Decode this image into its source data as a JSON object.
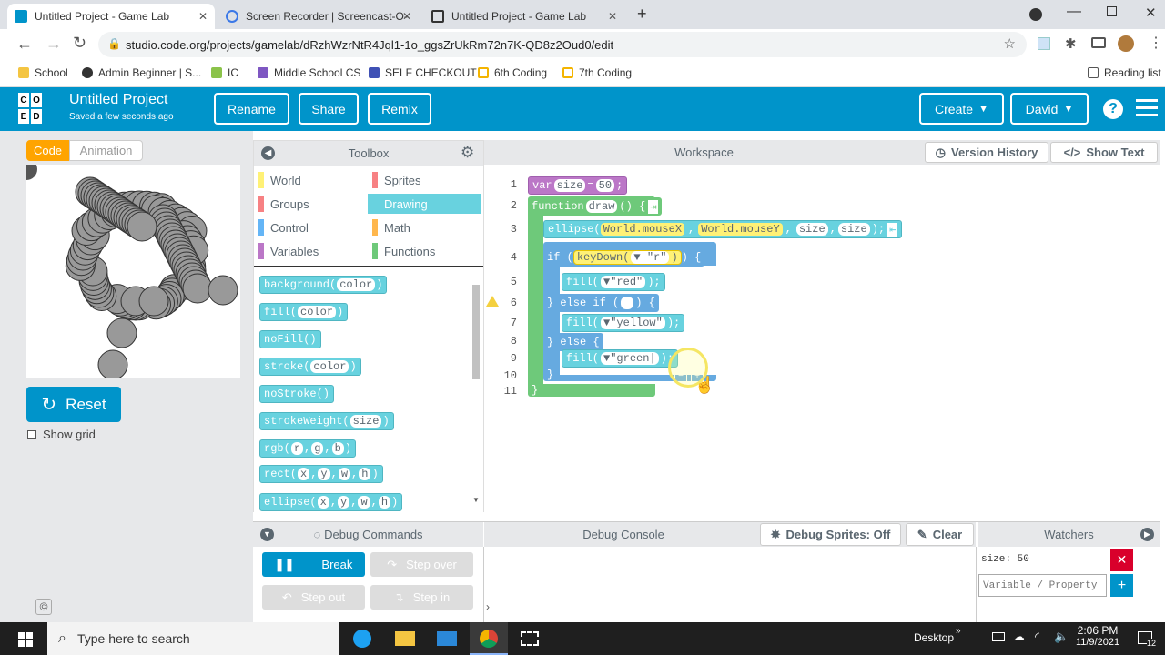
{
  "browser": {
    "tabs": [
      {
        "title": "Untitled Project - Game Lab",
        "active": true
      },
      {
        "title": "Screen Recorder | Screencast-O-",
        "active": false
      },
      {
        "title": "Untitled Project - Game Lab",
        "active": false
      }
    ],
    "url": "studio.code.org/projects/gamelab/dRzhWzrNtR4Jql1-1o_ggsZrUkRm72n7K-QD8z2Oud0/edit",
    "bookmarks": [
      "School",
      "Admin Beginner | S...",
      "IC",
      "Middle School CS",
      "SELF CHECKOUT",
      "6th Coding",
      "7th Coding"
    ],
    "reading_list": "Reading list"
  },
  "header": {
    "logo_letters": [
      "C",
      "O",
      "D",
      "E"
    ],
    "project_title": "Untitled Project",
    "saved_status": "Saved a few seconds ago",
    "rename": "Rename",
    "share": "Share",
    "remix": "Remix",
    "create": "Create",
    "user": "David",
    "help": "?"
  },
  "left": {
    "tab_code": "Code",
    "tab_animation": "Animation",
    "reset": "Reset",
    "show_grid": "Show grid",
    "copyright": "©"
  },
  "toolbox": {
    "title": "Toolbox",
    "categories": [
      {
        "label": "World",
        "color": "#fff176"
      },
      {
        "label": "Sprites",
        "color": "#f78183"
      },
      {
        "label": "Groups",
        "color": "#f78183"
      },
      {
        "label": "Drawing",
        "color": "#68d2df"
      },
      {
        "label": "Control",
        "color": "#64b5f6"
      },
      {
        "label": "Math",
        "color": "#ffb74d"
      },
      {
        "label": "Variables",
        "color": "#bb77c7"
      },
      {
        "label": "Functions",
        "color": "#6ec97a"
      }
    ],
    "selected": "Drawing",
    "blocks": [
      {
        "name": "background",
        "args": [
          "color"
        ]
      },
      {
        "name": "fill",
        "args": [
          "color"
        ]
      },
      {
        "name": "noFill",
        "args": []
      },
      {
        "name": "stroke",
        "args": [
          "color"
        ]
      },
      {
        "name": "noStroke",
        "args": []
      },
      {
        "name": "strokeWeight",
        "args": [
          "size"
        ]
      },
      {
        "name": "rgb",
        "args": [
          "r",
          "g",
          "b"
        ]
      },
      {
        "name": "rect",
        "args": [
          "x",
          "y",
          "w",
          "h"
        ]
      },
      {
        "name": "ellipse",
        "args": [
          "x",
          "y",
          "w",
          "h"
        ]
      }
    ]
  },
  "workspace": {
    "title": "Workspace",
    "version_history": "Version History",
    "show_text": "Show Text",
    "line_numbers": [
      "1",
      "2",
      "3",
      "4",
      "5",
      "6",
      "7",
      "8",
      "9",
      "10",
      "11"
    ],
    "code": {
      "l1_var": "var",
      "l1_name": "size",
      "l1_eq": "=",
      "l1_val": "50",
      "l2_fn": "function",
      "l2_name": "draw",
      "l2_rest": "() {",
      "l3_call": "ellipse(",
      "l3_a1": "World.mouseX",
      "l3_a2": "World.mouseY",
      "l3_a3": "size",
      "l3_a4": "size",
      "l3_end": ");",
      "l4_if": "if (",
      "l4_kd": "keyDown(",
      "l4_key": "\"r\"",
      "l4_end": ") {",
      "l5_fill": "fill(",
      "l5_val": "\"red\"",
      "l6_else_if": "} else if (",
      "l6_end": ") {",
      "l7_fill": "fill(",
      "l7_val": "\"yellow\"",
      "l8_else": "} else {",
      "l9_fill": "fill(",
      "l9_val": "\"green",
      "l10_close": "}",
      "l11_close": "}",
      "paren_close": ");"
    }
  },
  "debug": {
    "debug_commands": "Debug Commands",
    "debug_console": "Debug Console",
    "debug_sprites": "Debug Sprites: Off",
    "clear": "Clear",
    "watchers": "Watchers",
    "break": "Break",
    "step_over": "Step over",
    "step_out": "Step out",
    "step_in": "Step in",
    "watch_value": "size: 50",
    "watch_placeholder": "Variable / Property",
    "prompt": "›"
  },
  "taskbar": {
    "search_placeholder": "Type here to search",
    "desktop": "Desktop",
    "time": "2:06 PM",
    "date": "11/9/2021",
    "notifications": "12"
  }
}
